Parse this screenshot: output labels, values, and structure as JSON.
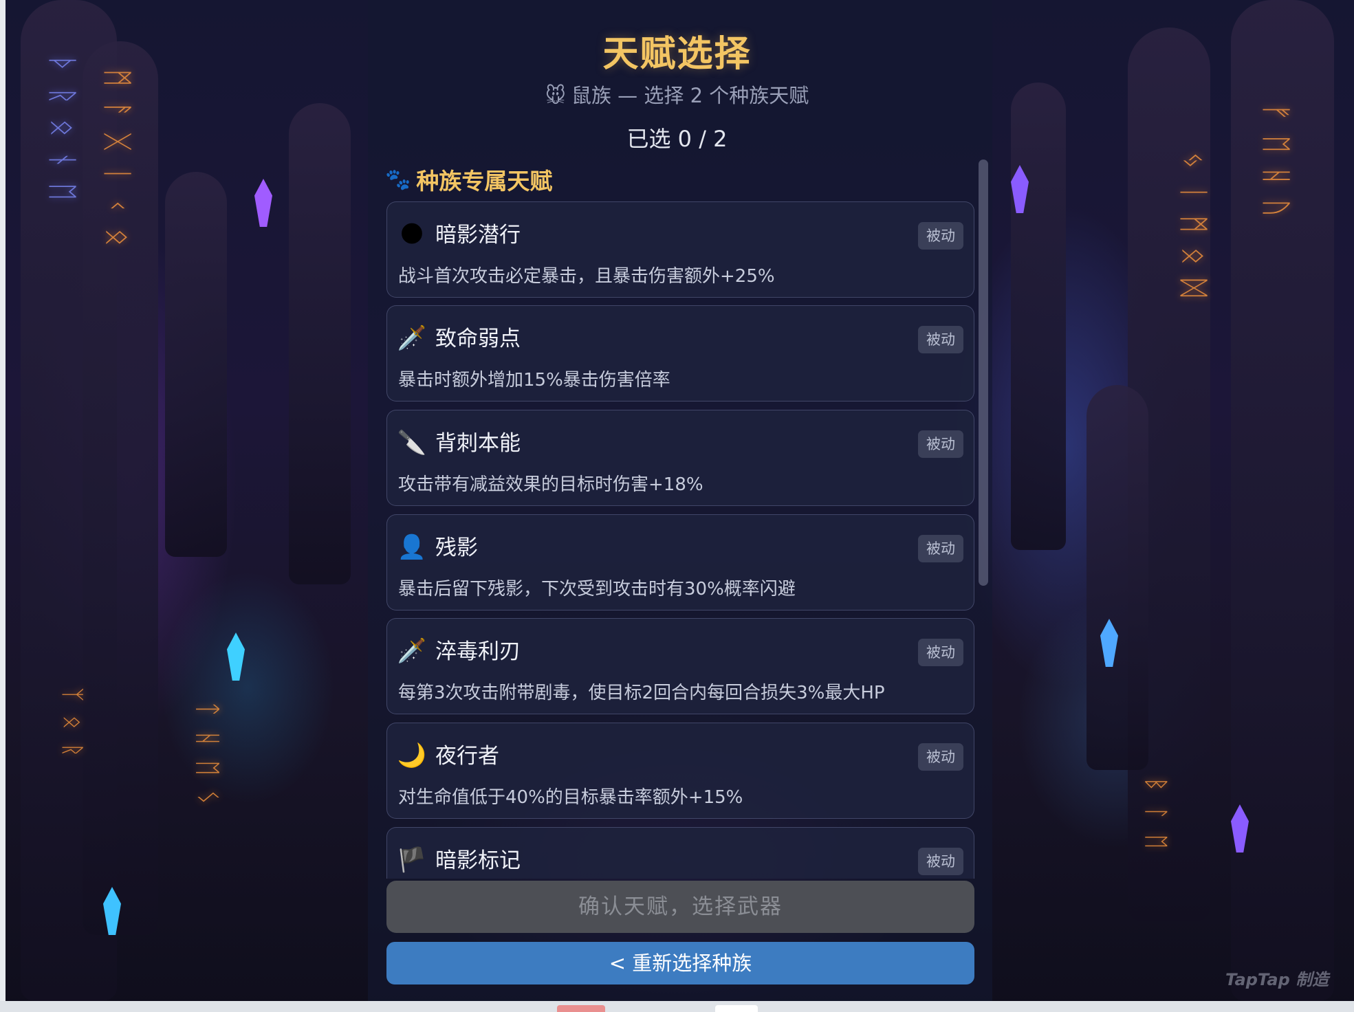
{
  "header": {
    "title": "天赋选择",
    "subtitle_icon": "🐭",
    "subtitle": "鼠族 — 选择 2 个种族天赋",
    "counter": "已选 0 / 2"
  },
  "section": {
    "icon": "🐾",
    "title": "种族专属天赋"
  },
  "talents": [
    {
      "icon": "🌑",
      "icon_name": "moon-icon",
      "name": "暗影潜行",
      "badge": "被动",
      "desc": "战斗首次攻击必定暴击，且暴击伤害额外+25%"
    },
    {
      "icon": "🗡️",
      "icon_name": "dagger-icon",
      "name": "致命弱点",
      "badge": "被动",
      "desc": "暴击时额外增加15%暴击伤害倍率"
    },
    {
      "icon": "🔪",
      "icon_name": "knife-icon",
      "name": "背刺本能",
      "badge": "被动",
      "desc": "攻击带有减益效果的目标时伤害+18%"
    },
    {
      "icon": "👤",
      "icon_name": "silhouette-icon",
      "name": "残影",
      "badge": "被动",
      "desc": "暴击后留下残影，下次受到攻击时有30%概率闪避"
    },
    {
      "icon": "🗡️",
      "icon_name": "dagger-icon",
      "name": "淬毒利刃",
      "badge": "被动",
      "desc": "每第3次攻击附带剧毒，使目标2回合内每回合损失3%最大HP"
    },
    {
      "icon": "🌙",
      "icon_name": "crescent-moon-icon",
      "name": "夜行者",
      "badge": "被动",
      "desc": "对生命值低于40%的目标暴击率额外+15%"
    },
    {
      "icon": "🏴",
      "icon_name": "black-flag-icon",
      "name": "暗影标记",
      "badge": "被动",
      "desc": ""
    }
  ],
  "buttons": {
    "confirm": "确认天赋，选择武器",
    "back": "< 重新选择种族"
  },
  "watermark": "TapTap 制造",
  "colors": {
    "title": "#f3c563",
    "confirm_disabled": "#4d4f55",
    "back_button": "#3d7cc1",
    "card_bg": "#1e223c"
  }
}
